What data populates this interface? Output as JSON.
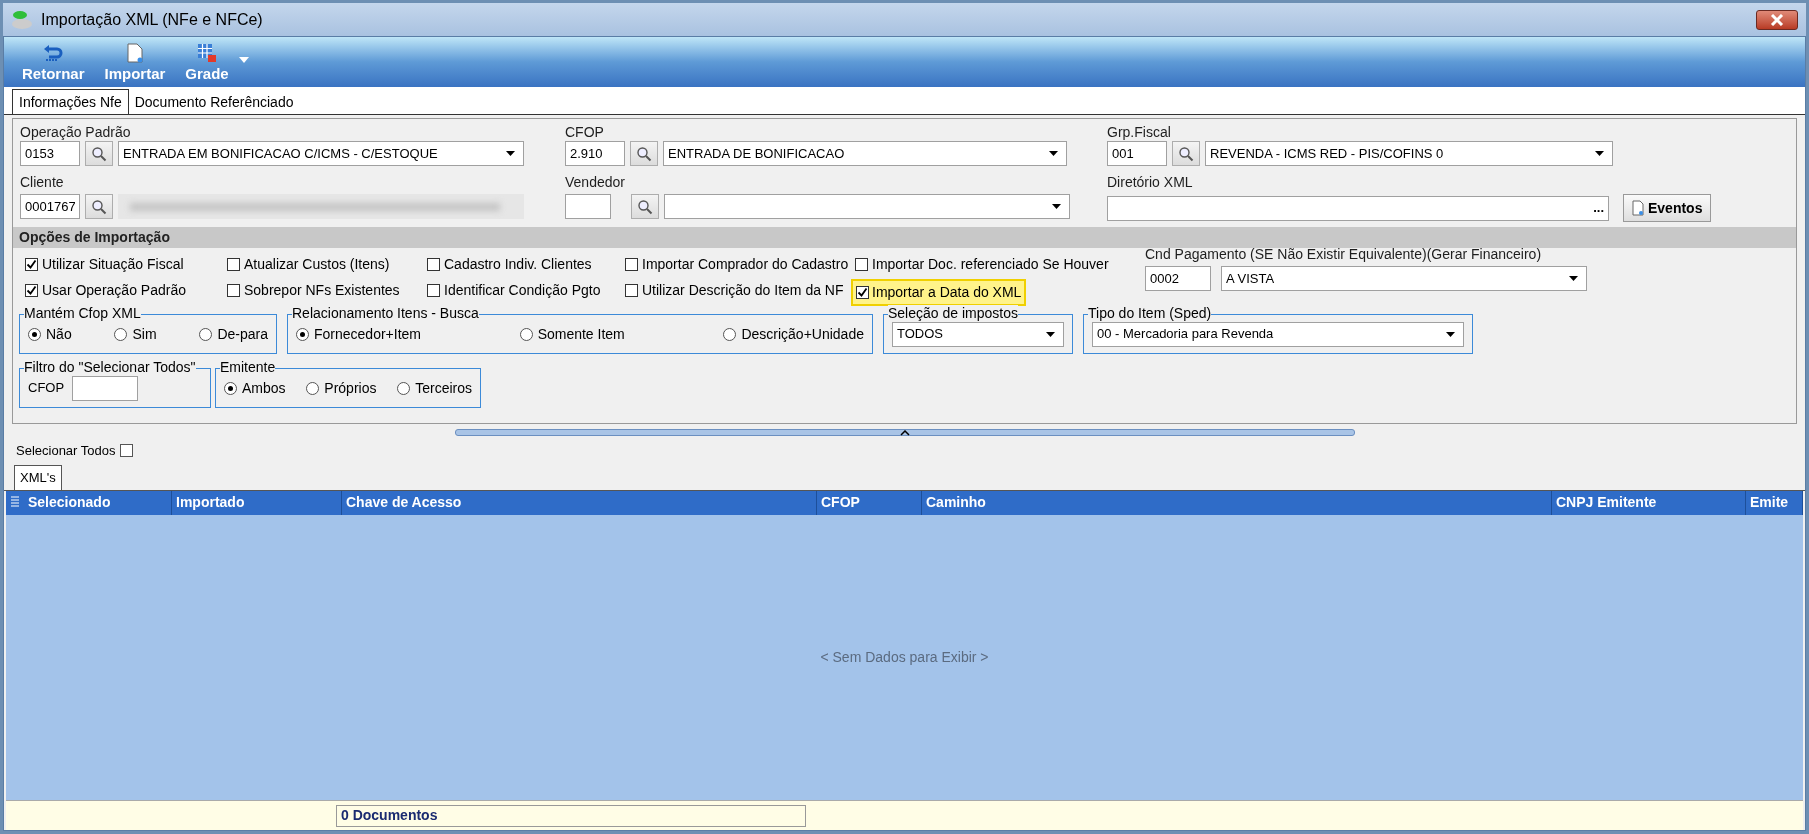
{
  "window": {
    "title": "Importação XML (NFe e NFCe)"
  },
  "toolbar": [
    {
      "label": "Retornar",
      "kind": "return"
    },
    {
      "label": "Importar",
      "kind": "import"
    },
    {
      "label": "Grade",
      "kind": "grid"
    }
  ],
  "tabs": [
    {
      "label": "Informações Nfe",
      "selected": true
    },
    {
      "label": "Documento Referênciado",
      "selected": false
    }
  ],
  "fields": {
    "operacao": {
      "label": "Operação Padrão",
      "code": "0153",
      "value": "ENTRADA EM BONIFICACAO C/ICMS - C/ESTOQUE"
    },
    "cfop": {
      "label": "CFOP",
      "code": "2.910",
      "value": "ENTRADA DE BONIFICACAO"
    },
    "grp_fiscal": {
      "label": "Grp.Fiscal",
      "code": "001",
      "value": "REVENDA - ICMS RED - PIS/COFINS 0"
    },
    "cliente": {
      "label": "Cliente",
      "code": "0001767",
      "redacted": true
    },
    "vendedor": {
      "label": "Vendedor"
    },
    "diretorio": {
      "label": "Diretório XML",
      "browse": "...",
      "button": "Eventos"
    }
  },
  "options_title": "Opções de Importação",
  "checkboxes": [
    [
      {
        "label": "Utilizar Situação Fiscal",
        "checked": true,
        "highlighted": false
      },
      {
        "label": "Usar Operação Padrão",
        "checked": true,
        "highlighted": false
      }
    ],
    [
      {
        "label": "Atualizar Custos (Itens)",
        "checked": false,
        "highlighted": false
      },
      {
        "label": "Sobrepor NFs Existentes",
        "checked": false,
        "highlighted": false
      }
    ],
    [
      {
        "label": "Cadastro Indiv. Clientes",
        "checked": false,
        "highlighted": false
      },
      {
        "label": "Identificar Condição Pgto",
        "checked": false,
        "highlighted": false
      }
    ],
    [
      {
        "label": "Importar Comprador do Cadastro",
        "checked": false,
        "highlighted": false
      },
      {
        "label": "Utilizar Descrição do Item da NF",
        "checked": false,
        "highlighted": false
      }
    ],
    [
      {
        "label": "Importar Doc. referenciado Se Houver",
        "checked": false,
        "highlighted": false
      },
      {
        "label": "Importar a Data do XML",
        "checked": true,
        "highlighted": true
      }
    ]
  ],
  "pagamento": {
    "label": "Cnd Pagamento (SE Não Existir Equivalente)(Gerar Financeiro)",
    "code": "0002",
    "value": "A VISTA"
  },
  "groups_row1": [
    {
      "title": "Mantém Cfop XML",
      "kind": "radios",
      "options": [
        {
          "label": "Não",
          "selected": true
        },
        {
          "label": "Sim",
          "selected": false
        },
        {
          "label": "De-para",
          "selected": false
        }
      ]
    },
    {
      "title": "Relacionamento Itens - Busca",
      "kind": "radios",
      "options": [
        {
          "label": "Fornecedor+Item",
          "selected": true
        },
        {
          "label": "Somente Item",
          "selected": false
        },
        {
          "label": "Descrição+Unidade",
          "selected": false
        }
      ]
    },
    {
      "title": "Seleção de impostos",
      "kind": "combo",
      "value": "TODOS"
    },
    {
      "title": "Tipo do Item (Sped)",
      "kind": "combo",
      "value": "00 - Mercadoria para Revenda"
    }
  ],
  "groups_row2": [
    {
      "title": "Filtro do \"Selecionar Todos\"",
      "kind": "input",
      "label": "CFOP"
    },
    {
      "title": "Emitente",
      "kind": "radios",
      "options": [
        {
          "label": "Ambos",
          "selected": true
        },
        {
          "label": "Próprios",
          "selected": false
        },
        {
          "label": "Terceiros",
          "selected": false
        }
      ]
    }
  ],
  "select_all": {
    "label": "Selecionar Todos",
    "checked": false
  },
  "grid_tab": {
    "label": "XML's",
    "selected": true
  },
  "table": {
    "columns": [
      "Selecionado",
      "Importado",
      "Chave de Acesso",
      "CFOP",
      "Caminho",
      "CNPJ Emitente",
      "Emite"
    ],
    "empty": "< Sem Dados para Exibir >"
  },
  "status_bar": {
    "count": "0 Documentos"
  }
}
